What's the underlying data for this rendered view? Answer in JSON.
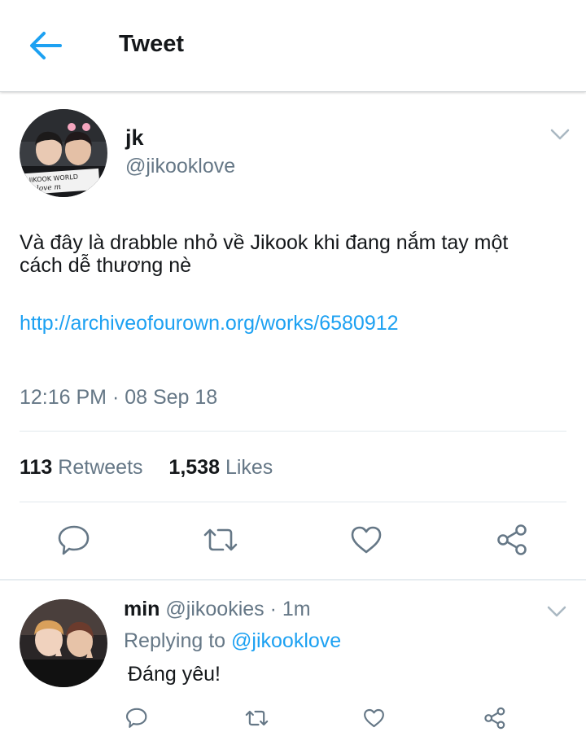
{
  "header": {
    "title": "Tweet"
  },
  "tweet": {
    "author_name": "jk",
    "author_handle": "@jikooklove",
    "text": "Và đây là drabble nhỏ về Jikook khi đang nắm tay một cách dễ thương nè",
    "link": "http://archiveofourown.org/works/6580912",
    "timestamp": "12:16 PM · 08 Sep 18",
    "retweets_count": "113",
    "retweets_label": "Retweets",
    "likes_count": "1,538",
    "likes_label": "Likes",
    "avatar_caption": "JIKOOK WORLD / I love m"
  },
  "reply": {
    "author_name": "min",
    "author_handle": "@jikookies",
    "time": "· 1m",
    "replying_label": "Replying to",
    "replying_to": "@jikooklove",
    "text": "Đáng yêu!"
  },
  "colors": {
    "accent": "#1da1f2",
    "secondary_text": "#657786",
    "icon_gray": "#657786",
    "divider": "#e1e8ed"
  },
  "icons": [
    "back-arrow-icon",
    "chevron-down-icon",
    "reply-icon",
    "retweet-icon",
    "like-icon",
    "share-icon"
  ]
}
